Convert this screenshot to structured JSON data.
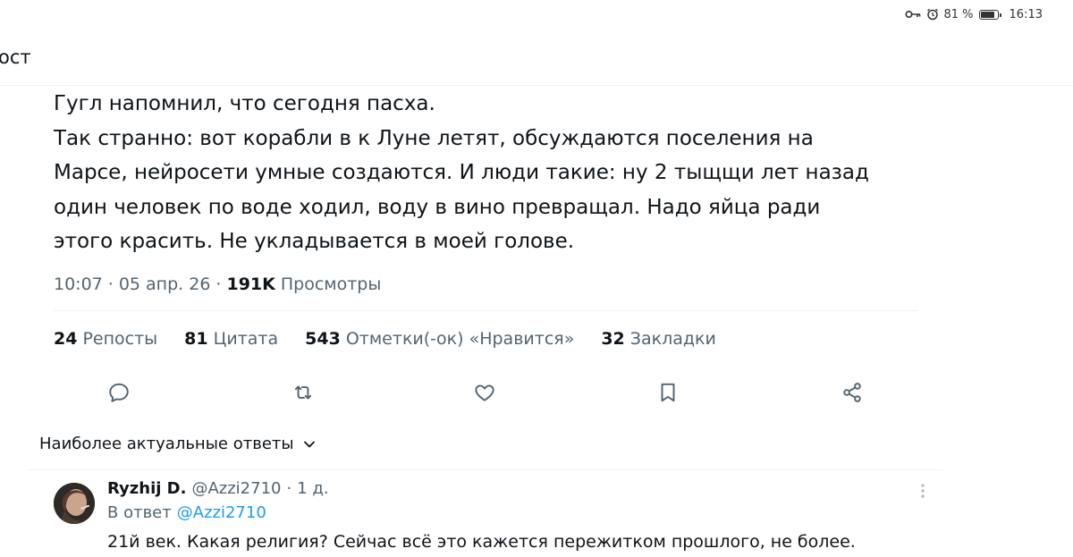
{
  "status_bar": {
    "battery_percent": "81 %",
    "time": "16:13",
    "icons": [
      "key-icon",
      "alarm-icon",
      "battery-icon"
    ]
  },
  "header": {
    "title": "ост"
  },
  "tweet": {
    "text_lines": [
      "Гугл напомнил, что сегодня пасха.",
      "Так странно: вот корабли в к Луне летят, обсуждаются поселения на",
      "Марсе, нейросети умные создаются. И люди такие: ну 2 тыщщи лет назад",
      "один человек по воде ходил, воду в вино превращал. Надо яйца ради",
      "этого красить. Не укладывается в моей голове."
    ],
    "time": "10:07",
    "date": "05 апр. 26",
    "separator": "·",
    "views_count": "191K",
    "views_label": "Просмотры"
  },
  "stats": {
    "reposts": {
      "n": "24",
      "label": "Репосты"
    },
    "quotes": {
      "n": "81",
      "label": "Цитата"
    },
    "likes": {
      "n": "543",
      "label": "Отметки(-ок) «Нравится»"
    },
    "bookmarks": {
      "n": "32",
      "label": "Закладки"
    }
  },
  "actions": [
    "reply-icon",
    "retweet-icon",
    "like-icon",
    "bookmark-icon",
    "share-icon"
  ],
  "replies_filter": {
    "label": "Наиболее актуальные ответы"
  },
  "reply": {
    "name": "Ryzhij D.",
    "handle": "@Azzi2710",
    "separator": "·",
    "age": "1 д.",
    "reply_to_label": "В ответ",
    "reply_to_handle": "@Azzi2710",
    "text": "21й век. Какая религия? Сейчас всё это кажется пережитком прошлого, не более."
  },
  "colors": {
    "text": "#0f1419",
    "secondary": "#536471",
    "accent": "#1d9bf0",
    "divider": "#eff3f4"
  }
}
